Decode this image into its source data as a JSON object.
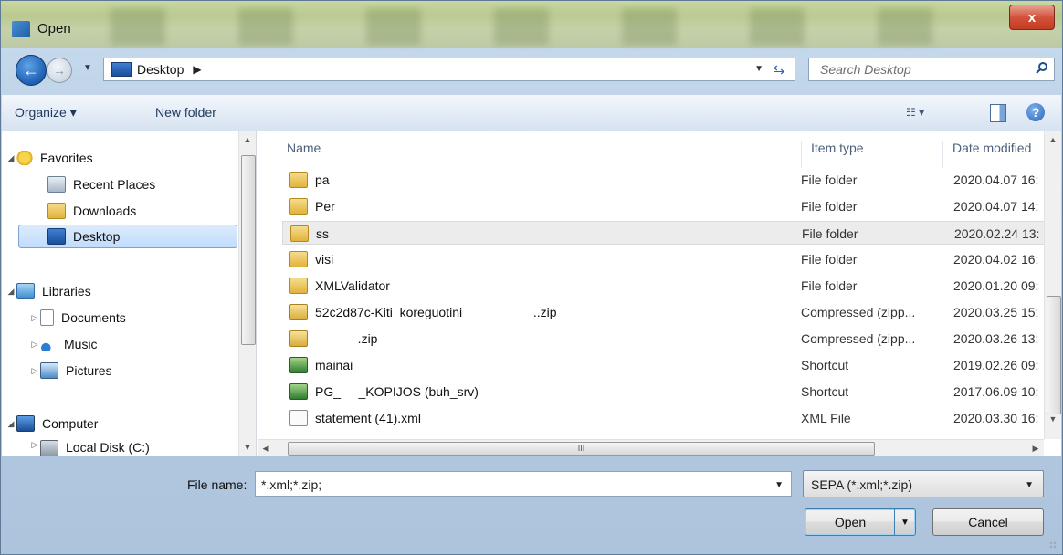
{
  "window": {
    "title": "Open",
    "close_glyph": "x"
  },
  "nav": {
    "back_glyph": "←",
    "forward_glyph": "→",
    "address": {
      "location": "Desktop",
      "separator": "▶"
    },
    "refresh_glyph": "⇆",
    "search": {
      "placeholder": "Search Desktop"
    }
  },
  "toolbar": {
    "organize_label": "Organize ▾",
    "new_folder_label": "New folder",
    "views_glyph": "☷ ▾",
    "help_glyph": "?"
  },
  "sidebar": {
    "favorites": {
      "label": "Favorites",
      "items": [
        "Recent Places",
        "Downloads",
        "Desktop"
      ]
    },
    "libraries": {
      "label": "Libraries",
      "items": [
        "Documents",
        "Music",
        "Pictures"
      ]
    },
    "computer": {
      "label": "Computer",
      "items": [
        "Local Disk (C:)"
      ]
    },
    "expanded_glyph": "◢",
    "collapsed_glyph": "▷",
    "scroll_up": "▲",
    "scroll_down": "▼"
  },
  "files": {
    "columns": {
      "name": "Name",
      "type": "Item type",
      "date": "Date modified"
    },
    "rows": [
      {
        "name": "pa",
        "type": "File folder",
        "date": "2020.04.07 16:",
        "icon": "folder"
      },
      {
        "name": "Per",
        "type": "File folder",
        "date": "2020.04.07 14:",
        "icon": "folder"
      },
      {
        "name": "ss",
        "type": "File folder",
        "date": "2020.02.24 13:",
        "icon": "folder"
      },
      {
        "name": "visi",
        "type": "File folder",
        "date": "2020.04.02 16:",
        "icon": "folder"
      },
      {
        "name": "XMLValidator",
        "type": "File folder",
        "date": "2020.01.20 09:",
        "icon": "folder"
      },
      {
        "name": "52c2d87c-Kiti_koreguotini                    ..zip",
        "type": "Compressed (zipp...",
        "date": "2020.03.25 15:",
        "icon": "zip"
      },
      {
        "name": "            .zip",
        "type": "Compressed (zipp...",
        "date": "2020.03.26 13:",
        "icon": "zip"
      },
      {
        "name": "mainai",
        "type": "Shortcut",
        "date": "2019.02.26 09:",
        "icon": "shortcut"
      },
      {
        "name": "PG_     _KOPIJOS (buh_srv)",
        "type": "Shortcut",
        "date": "2017.06.09 10:",
        "icon": "shortcut"
      },
      {
        "name": "statement (41).xml",
        "type": "XML File",
        "date": "2020.03.30 16:",
        "icon": "xml"
      }
    ],
    "hscroll_thumb": "III"
  },
  "footer": {
    "file_name_label": "File name:",
    "file_name_value": "*.xml;*.zip;",
    "filter_value": "SEPA (*.xml;*.zip)",
    "open_label": "Open",
    "cancel_label": "Cancel",
    "dropdown_glyph": "▼"
  }
}
